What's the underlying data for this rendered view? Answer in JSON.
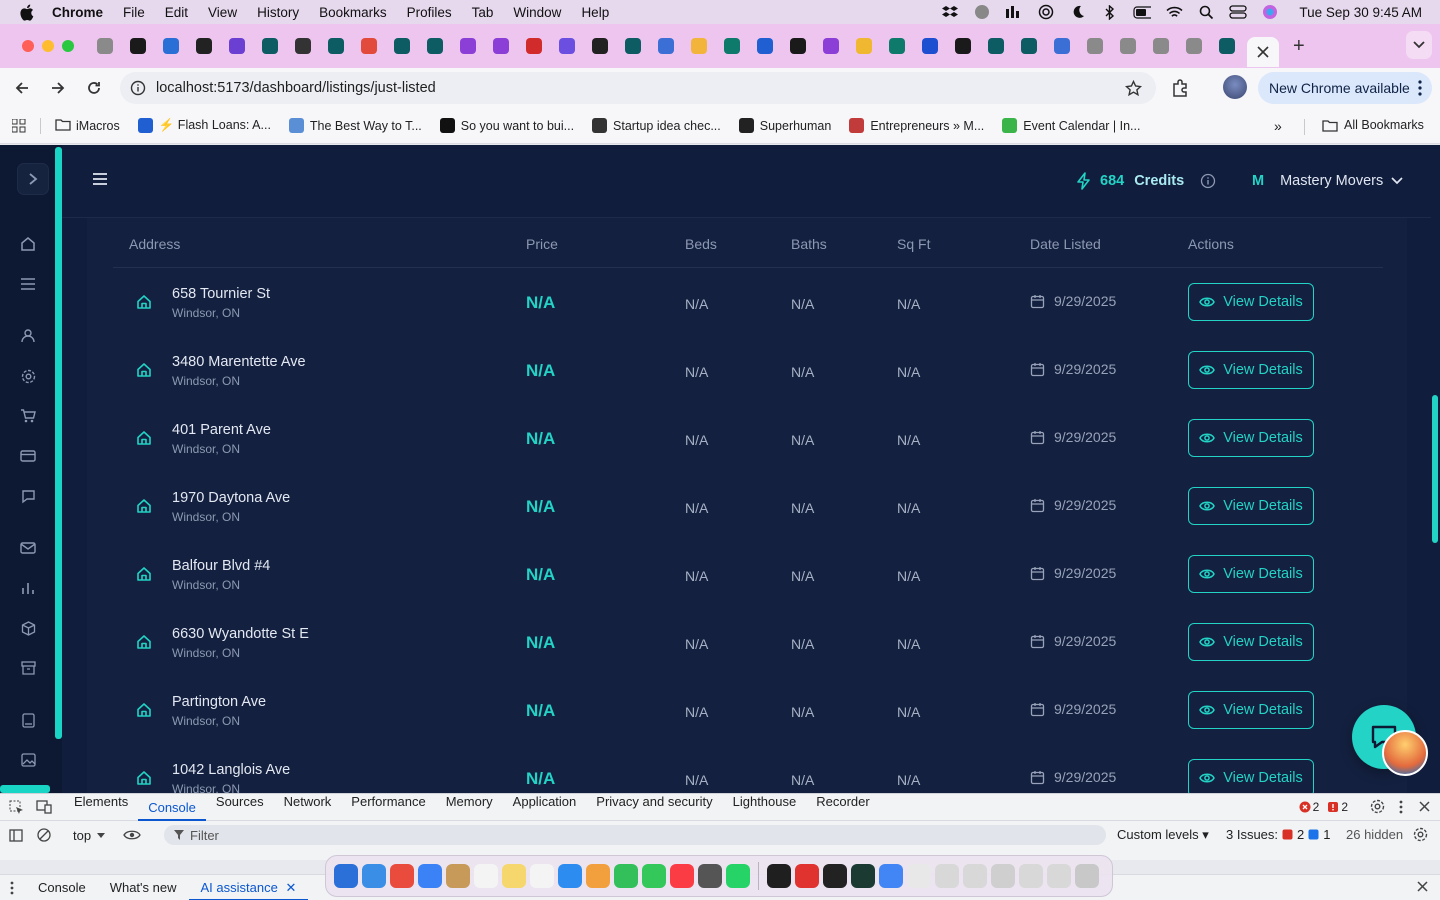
{
  "menubar": {
    "app_name": "Chrome",
    "items": [
      "File",
      "Edit",
      "View",
      "History",
      "Bookmarks",
      "Profiles",
      "Tab",
      "Window",
      "Help"
    ],
    "clock": "Tue Sep 30  9:45 AM"
  },
  "browser": {
    "url": "localhost:5173/dashboard/listings/just-listed",
    "update_label": "New Chrome available",
    "tab_favicon_colors": [
      "#8a8a8a",
      "#1a1a1a",
      "#2a6fd6",
      "#222",
      "#6b3fd1",
      "#0d5c63",
      "#333",
      "#0d5c63",
      "#e24b3b",
      "#0d5c63",
      "#0d5c63",
      "#8b3fd6",
      "#8b3fd6",
      "#d12b2b",
      "#6b4fe0",
      "#222",
      "#0d5c63",
      "#3b6fd6",
      "#f3b43c",
      "#0d7a6b",
      "#1f5fd1",
      "#1a1a1a",
      "#8b3fd6",
      "#f0b730",
      "#0d7a6b",
      "#1f4fd1",
      "#1a1a1a",
      "#0d5c63",
      "#0d5c63",
      "#3b6fd6",
      "#8a8a8a",
      "#8a8a8a",
      "#8a8a8a",
      "#8a8a8a",
      "#0d5c63",
      "#8a8a8a"
    ]
  },
  "bookmarks": [
    {
      "label": "iMacros",
      "color": "#555"
    },
    {
      "label": "⚡ Flash Loans: A...",
      "color": "#1f5fd1"
    },
    {
      "label": "The Best Way to T...",
      "color": "#5a8fd6"
    },
    {
      "label": "So you want to bui...",
      "color": "#111"
    },
    {
      "label": "Startup idea chec...",
      "color": "#333"
    },
    {
      "label": "Superhuman",
      "color": "#222"
    },
    {
      "label": "Entrepreneurs » M...",
      "color": "#c23b3b"
    },
    {
      "label": "Event Calendar | In...",
      "color": "#3bb54a"
    }
  ],
  "all_bookmarks": "All Bookmarks",
  "header": {
    "credits_count": "684",
    "credits_label": "Credits",
    "company_initial": "M",
    "company_name": "Mastery Movers"
  },
  "table": {
    "columns": [
      "Address",
      "Price",
      "Beds",
      "Baths",
      "Sq Ft",
      "Date Listed",
      "Actions"
    ],
    "action_label": "View Details",
    "rows": [
      {
        "address": "658 Tournier St",
        "city": "Windsor, ON",
        "price": "N/A",
        "beds": "N/A",
        "baths": "N/A",
        "sqft": "N/A",
        "date": "9/29/2025"
      },
      {
        "address": "3480 Marentette Ave",
        "city": "Windsor, ON",
        "price": "N/A",
        "beds": "N/A",
        "baths": "N/A",
        "sqft": "N/A",
        "date": "9/29/2025"
      },
      {
        "address": "401 Parent Ave",
        "city": "Windsor, ON",
        "price": "N/A",
        "beds": "N/A",
        "baths": "N/A",
        "sqft": "N/A",
        "date": "9/29/2025"
      },
      {
        "address": "1970 Daytona Ave",
        "city": "Windsor, ON",
        "price": "N/A",
        "beds": "N/A",
        "baths": "N/A",
        "sqft": "N/A",
        "date": "9/29/2025"
      },
      {
        "address": "Balfour Blvd #4",
        "city": "Windsor, ON",
        "price": "N/A",
        "beds": "N/A",
        "baths": "N/A",
        "sqft": "N/A",
        "date": "9/29/2025"
      },
      {
        "address": "6630 Wyandotte St E",
        "city": "Windsor, ON",
        "price": "N/A",
        "beds": "N/A",
        "baths": "N/A",
        "sqft": "N/A",
        "date": "9/29/2025"
      },
      {
        "address": "Partington Ave",
        "city": "Windsor, ON",
        "price": "N/A",
        "beds": "N/A",
        "baths": "N/A",
        "sqft": "N/A",
        "date": "9/29/2025"
      },
      {
        "address": "1042 Langlois Ave",
        "city": "Windsor, ON",
        "price": "N/A",
        "beds": "N/A",
        "baths": "N/A",
        "sqft": "N/A",
        "date": "9/29/2025"
      }
    ]
  },
  "devtools": {
    "tabs": [
      "Elements",
      "Console",
      "Sources",
      "Network",
      "Performance",
      "Memory",
      "Application",
      "Privacy and security",
      "Lighthouse",
      "Recorder"
    ],
    "active_tab": "Console",
    "error_count": "2",
    "warning_count": "2",
    "context": "top",
    "filter_placeholder": "Filter",
    "levels": "Custom levels",
    "issues_label": "3 Issues:",
    "issues_errors": "2",
    "issues_info": "1",
    "hidden": "26 hidden",
    "drawer_tabs": [
      "Console",
      "What's new",
      "AI assistance"
    ]
  },
  "colors": {
    "accent": "#22d3c6",
    "app_bg": "#111d3c",
    "sidebar_bg": "#0d1833"
  }
}
